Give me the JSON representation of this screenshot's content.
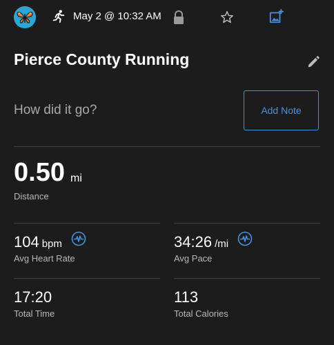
{
  "header": {
    "date": "May 2 @ 10:32 AM",
    "icons": [
      "monarch-butterfly-avatar",
      "running-icon",
      "lock-icon",
      "star-icon",
      "add-photo-icon"
    ]
  },
  "activity": {
    "title": "Pierce County Running",
    "prompt": "How did it go?",
    "add_note_label": "Add Note"
  },
  "distance": {
    "value": "0.50",
    "unit": "mi",
    "label": "Distance"
  },
  "stats": {
    "heart_rate": {
      "value": "104",
      "unit": "bpm",
      "label": "Avg Heart Rate"
    },
    "pace": {
      "value": "34:26",
      "unit": "/mi",
      "label": "Avg Pace"
    },
    "time": {
      "value": "17:20",
      "label": "Total Time"
    },
    "calories": {
      "value": "113",
      "label": "Total Calories"
    }
  },
  "colors": {
    "background": "#1c1c1c",
    "accent": "#4a90e2",
    "divider": "#444444"
  }
}
